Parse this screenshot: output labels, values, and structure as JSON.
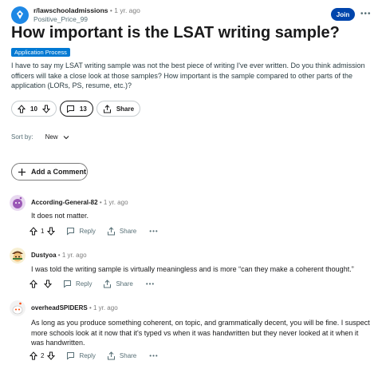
{
  "post": {
    "subreddit": "r/lawschooladmissions",
    "age": "1 yr. ago",
    "author": "Positive_Price_99",
    "join_label": "Join",
    "more_label": "•••",
    "title": "How important is the LSAT writing sample?",
    "flair": "Application Process",
    "body": "I have to say my LSAT writing sample was not the best piece of writing I've ever written. Do you think admission officers will take a close look at those samples? How important is the sample compared to other parts of the application (LORs, PS, resume, etc.)?",
    "votes": "10",
    "comments_count": "13",
    "share_label": "Share"
  },
  "sort": {
    "label": "Sort by:",
    "value": "New"
  },
  "add_comment_label": "Add a Comment",
  "comments": [
    {
      "author": "According-General-82",
      "age": "1 yr. ago",
      "text": "It does not matter.",
      "votes": "1",
      "reply_label": "Reply",
      "share_label": "Share",
      "more_label": "•••"
    },
    {
      "author": "Dustyoa",
      "age": "1 yr. ago",
      "text": "I was told the writing sample is virtually meaningless and is more “can they make a coherent thought.”",
      "votes": "",
      "reply_label": "Reply",
      "share_label": "Share",
      "more_label": "•••"
    },
    {
      "author": "overheadSPIDERS",
      "age": "1 yr. ago",
      "text": "As long as you produce something coherent, on topic, and grammatically decent, you will be fine. I suspect more schools look at it now that it's typed vs when it was handwritten but they never looked at it when it was handwritten.",
      "votes": "2",
      "reply_label": "Reply",
      "share_label": "Share",
      "more_label": "•••"
    }
  ],
  "colors": {
    "join": "#0045ac",
    "flair": "#0079d3",
    "sub_icon": "#1e88e5"
  }
}
